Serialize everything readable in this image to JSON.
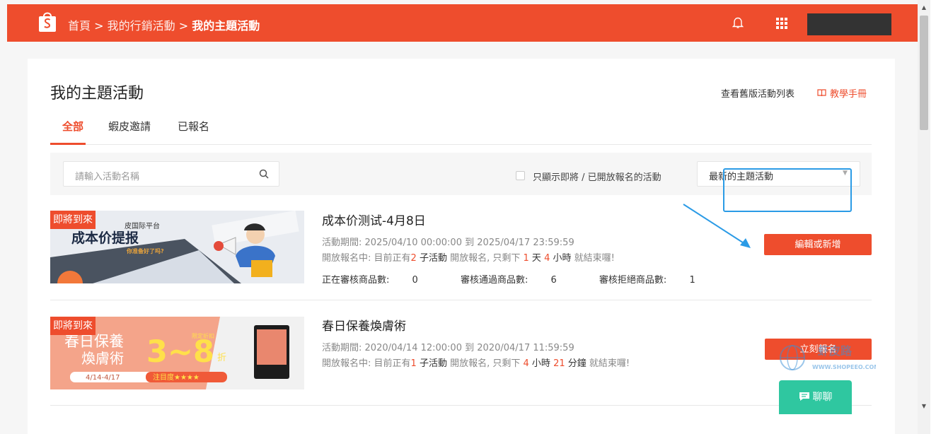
{
  "header": {
    "breadcrumb": [
      "首頁",
      "我的行銷活動",
      "我的主題活動"
    ],
    "separator": ">",
    "brand_color": "#ee4d2d",
    "icons": [
      "shopee-bag-icon",
      "bell-icon",
      "apps-grid-icon"
    ]
  },
  "page": {
    "title": "我的主題活動",
    "old_list_link": "查看舊版活動列表",
    "manual_link": "教學手冊"
  },
  "tabs": [
    {
      "label": "全部",
      "active": true
    },
    {
      "label": "蝦皮邀請",
      "active": false
    },
    {
      "label": "已報名",
      "active": false
    }
  ],
  "filter": {
    "search_placeholder": "請輸入活動名稱",
    "checkbox_label": "只顯示即將 / 已開放報名的活動",
    "checkbox_checked": false,
    "sort_value": "最新的主題活動"
  },
  "campaigns": [
    {
      "ribbon": "即將到來",
      "banner_text": {
        "platform": "皮国际平台",
        "headline": "成本价提报",
        "sub": "你准备好了吗?"
      },
      "title": "成本价测试-4月8日",
      "period_label": "活動期間:",
      "period_start": "2025/04/10 00:00:00",
      "period_to": "到",
      "period_end": "2025/04/17 23:59:59",
      "status_prefix": "開放報名中: 目前正有",
      "sub_count": "2",
      "sub_label": "子活動",
      "status_mid": "開放報名, 只剩下",
      "remain_1": "1",
      "unit_1": "天",
      "remain_2": "4",
      "unit_2": "小時",
      "status_suffix": "就結束囉!",
      "stats": [
        {
          "label": "正在審核商品數:",
          "value": "0"
        },
        {
          "label": "審核通過商品數:",
          "value": "6"
        },
        {
          "label": "審核拒絕商品數:",
          "value": "1"
        }
      ],
      "button": "編輯或新增"
    },
    {
      "ribbon": "即將到來",
      "banner_text": {
        "line1": "春日保養",
        "line2": "煥膚術",
        "discount": "3~8",
        "discount_unit": "折",
        "date": "4/14-4/17",
        "tag": "注目度★★★★",
        "badge": "限定折扣"
      },
      "title": "春日保養煥膚術",
      "period_label": "活動期間:",
      "period_start": "2020/04/14 12:00:00",
      "period_to": "到",
      "period_end": "2020/04/17 11:59:59",
      "status_prefix": "開放報名中: 目前正有",
      "sub_count": "1",
      "sub_label": "子活動",
      "status_mid": "開放報名, 只剩下",
      "remain_1": "4",
      "unit_1": "小時",
      "remain_2": "21",
      "unit_2": "分鐘",
      "status_suffix": "就結束囉!",
      "button": "立刻報名"
    }
  ],
  "watermark": {
    "text": "虾皮路",
    "url": "WWW.SHOPEEO.COM"
  },
  "chat": {
    "label": "聊聊"
  }
}
